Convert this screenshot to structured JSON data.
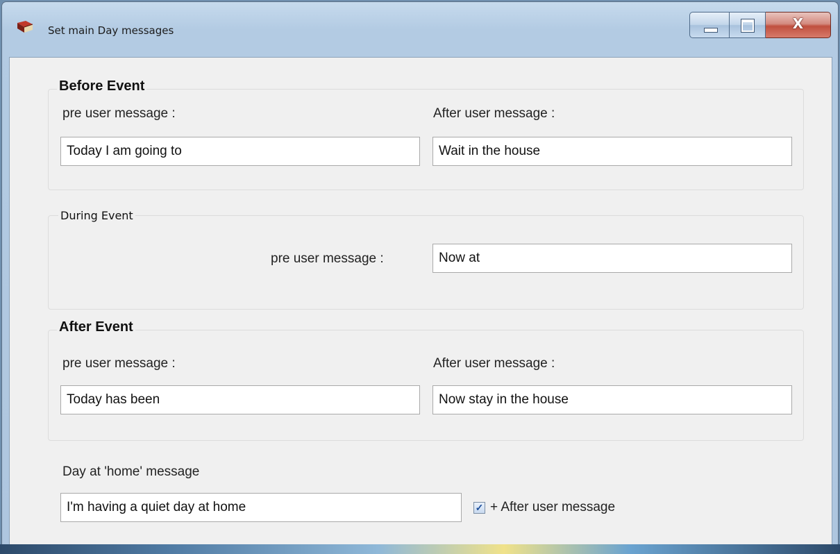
{
  "window": {
    "title": "Set main Day messages"
  },
  "caption": {
    "close_glyph": "X"
  },
  "before": {
    "legend": "Before Event",
    "pre_label": "pre user message :",
    "after_label": "After user message :",
    "pre_value": "Today I am going to",
    "after_value": "Wait in the house"
  },
  "during": {
    "legend": "During Event",
    "pre_label": "pre user message :",
    "pre_value": "Now at"
  },
  "after": {
    "legend": "After Event",
    "pre_label": "pre user message :",
    "after_label": "After user message :",
    "pre_value": "Today has been",
    "after_value": "Now stay in the house"
  },
  "home": {
    "label": "Day at 'home' message",
    "value": "I'm having a quiet day at home",
    "checkbox_checked": true,
    "checkbox_mark": "✓",
    "checkbox_label": "+ After user message"
  }
}
